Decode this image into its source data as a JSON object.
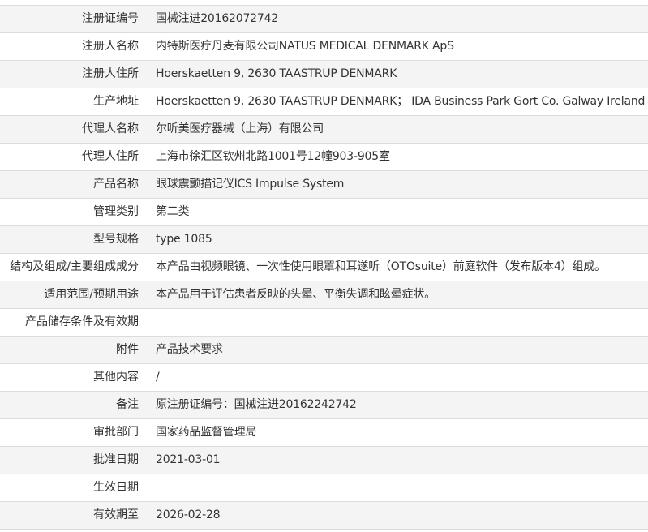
{
  "rows": [
    {
      "label": "注册证编号",
      "value": "国械注进20162072742"
    },
    {
      "label": "注册人名称",
      "value": "内特斯医疗丹麦有限公司NATUS MEDICAL DENMARK ApS"
    },
    {
      "label": "注册人住所",
      "value": "Hoerskaetten 9, 2630 TAASTRUP DENMARK"
    },
    {
      "label": "生产地址",
      "value": "Hoerskaetten 9, 2630 TAASTRUP DENMARK； IDA Business Park Gort Co. Galway Ireland"
    },
    {
      "label": "代理人名称",
      "value": "尔听美医疗器械（上海）有限公司"
    },
    {
      "label": "代理人住所",
      "value": "上海市徐汇区钦州北路1001号12幢903-905室"
    },
    {
      "label": "产品名称",
      "value": "眼球震颤描记仪ICS Impulse System"
    },
    {
      "label": "管理类别",
      "value": "第二类"
    },
    {
      "label": "型号规格",
      "value": "type 1085"
    },
    {
      "label": "结构及组成/主要组成成分",
      "value": "本产品由视频眼镜、一次性使用眼罩和耳遂听（OTOsuite）前庭软件（发布版本4）组成。"
    },
    {
      "label": "适用范围/预期用途",
      "value": "本产品用于评估患者反映的头晕、平衡失调和眩晕症状。"
    },
    {
      "label": "产品储存条件及有效期",
      "value": ""
    },
    {
      "label": "附件",
      "value": "产品技术要求"
    },
    {
      "label": "其他内容",
      "value": "/"
    },
    {
      "label": "备注",
      "value": "原注册证编号：国械注进20162242742"
    },
    {
      "label": "审批部门",
      "value": "国家药品监督管理局"
    },
    {
      "label": "批准日期",
      "value": "2021-03-01"
    },
    {
      "label": "生效日期",
      "value": ""
    },
    {
      "label": "有效期至",
      "value": "2026-02-28"
    }
  ]
}
